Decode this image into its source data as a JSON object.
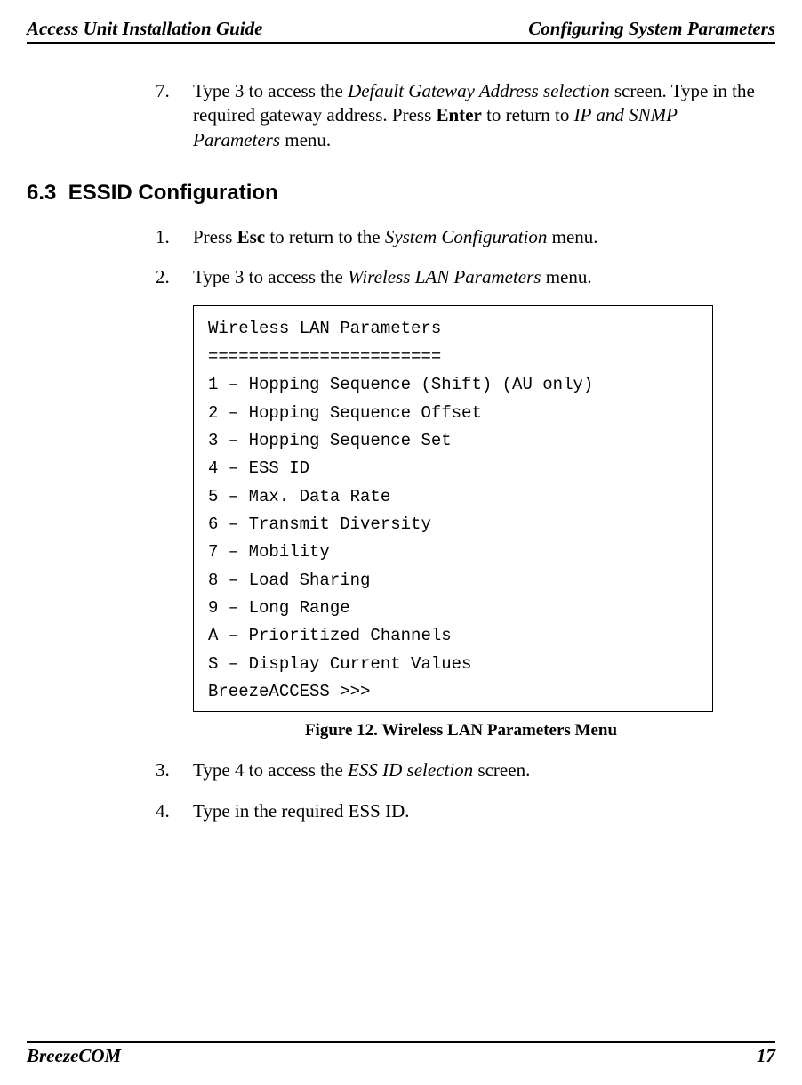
{
  "header": {
    "left": "Access Unit Installation Guide",
    "right": "Configuring System Parameters"
  },
  "step7": {
    "num": "7.",
    "t1": "Type 3 to access the ",
    "i1": "Default Gateway Address selection",
    "t2": " screen. Type in the required gateway address. Press ",
    "b1": "Enter",
    "t3": " to return to ",
    "i2": "IP and SNMP Parameters",
    "t4": " menu."
  },
  "section": {
    "num": "6.3",
    "title": "ESSID Configuration"
  },
  "step1": {
    "num": "1.",
    "t1": "Press ",
    "b1": "Esc",
    "t2": " to return to the ",
    "i1": "System Configuration",
    "t3": " menu."
  },
  "step2": {
    "num": "2.",
    "t1": "Type 3 to access the ",
    "i1": "Wireless LAN Parameters",
    "t2": " menu."
  },
  "code": {
    "l01": "Wireless LAN Parameters",
    "l02": "=======================",
    "l03": "1 – Hopping Sequence (Shift) (AU only)",
    "l04": "2 – Hopping Sequence Offset",
    "l05": "3 – Hopping Sequence Set",
    "l06": "4 – ESS ID",
    "l07": "5 – Max. Data Rate",
    "l08": "6 – Transmit Diversity",
    "l09": "7 – Mobility",
    "l10": "8 – Load Sharing",
    "l11": "9 – Long Range",
    "l12": "A – Prioritized Channels",
    "l13": "S – Display Current Values",
    "l14": "BreezeACCESS >>>"
  },
  "figure": {
    "label": "Figure 12.  Wireless LAN Parameters Menu"
  },
  "step3": {
    "num": "3.",
    "t1": "Type 4 to access the ",
    "i1": "ESS ID selection",
    "t2": " screen."
  },
  "step4": {
    "num": "4.",
    "t1": "Type in the required ESS ID."
  },
  "footer": {
    "left": "BreezeCOM",
    "right": "17"
  }
}
